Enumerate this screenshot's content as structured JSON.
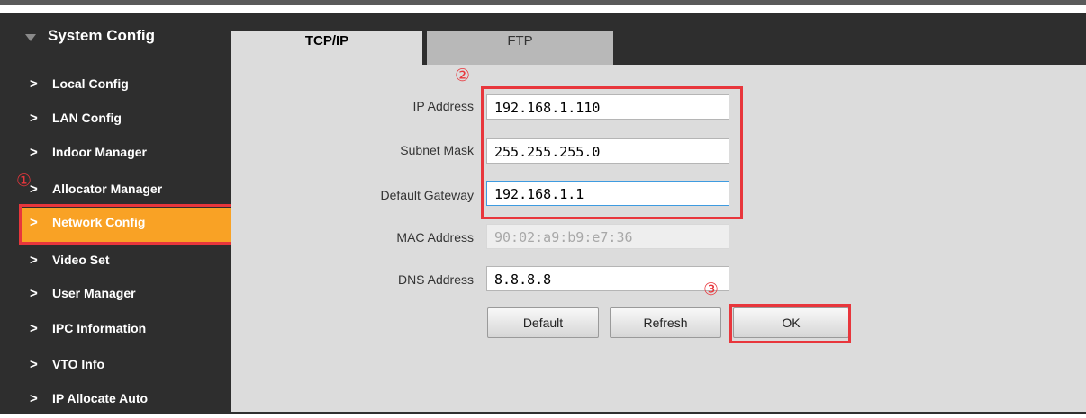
{
  "sidebar": {
    "header": "System Config",
    "items": [
      {
        "chevron": ">",
        "label": "Local Config"
      },
      {
        "chevron": ">",
        "label": "LAN Config"
      },
      {
        "chevron": ">",
        "label": "Indoor Manager"
      },
      {
        "chevron": ">",
        "label": "Allocator Manager"
      },
      {
        "chevron": ">",
        "label": "Network Config"
      },
      {
        "chevron": ">",
        "label": "Video Set"
      },
      {
        "chevron": ">",
        "label": "User Manager"
      },
      {
        "chevron": ">",
        "label": "IPC Information"
      },
      {
        "chevron": ">",
        "label": "VTO Info"
      },
      {
        "chevron": ">",
        "label": "IP Allocate Auto"
      }
    ],
    "active_index": 4
  },
  "tabs": [
    {
      "label": "TCP/IP",
      "active": true
    },
    {
      "label": "FTP",
      "active": false
    }
  ],
  "form": {
    "ip_label": "IP Address",
    "ip_value": "192.168.1.110",
    "subnet_label": "Subnet Mask",
    "subnet_value": "255.255.255.0",
    "gateway_label": "Default Gateway",
    "gateway_value": "192.168.1.1",
    "mac_label": "MAC Address",
    "mac_value": "90:02:a9:b9:e7:36",
    "dns_label": "DNS Address",
    "dns_value": "8.8.8.8"
  },
  "buttons": {
    "default": "Default",
    "refresh": "Refresh",
    "ok": "OK"
  },
  "annotations": {
    "step1": "①",
    "step2": "②",
    "step3": "③"
  },
  "colors": {
    "active_item": "#f9a225",
    "highlight": "#e8363c",
    "sidebar_bg": "#2e2e2e",
    "content_bg": "#dcdcdc"
  }
}
